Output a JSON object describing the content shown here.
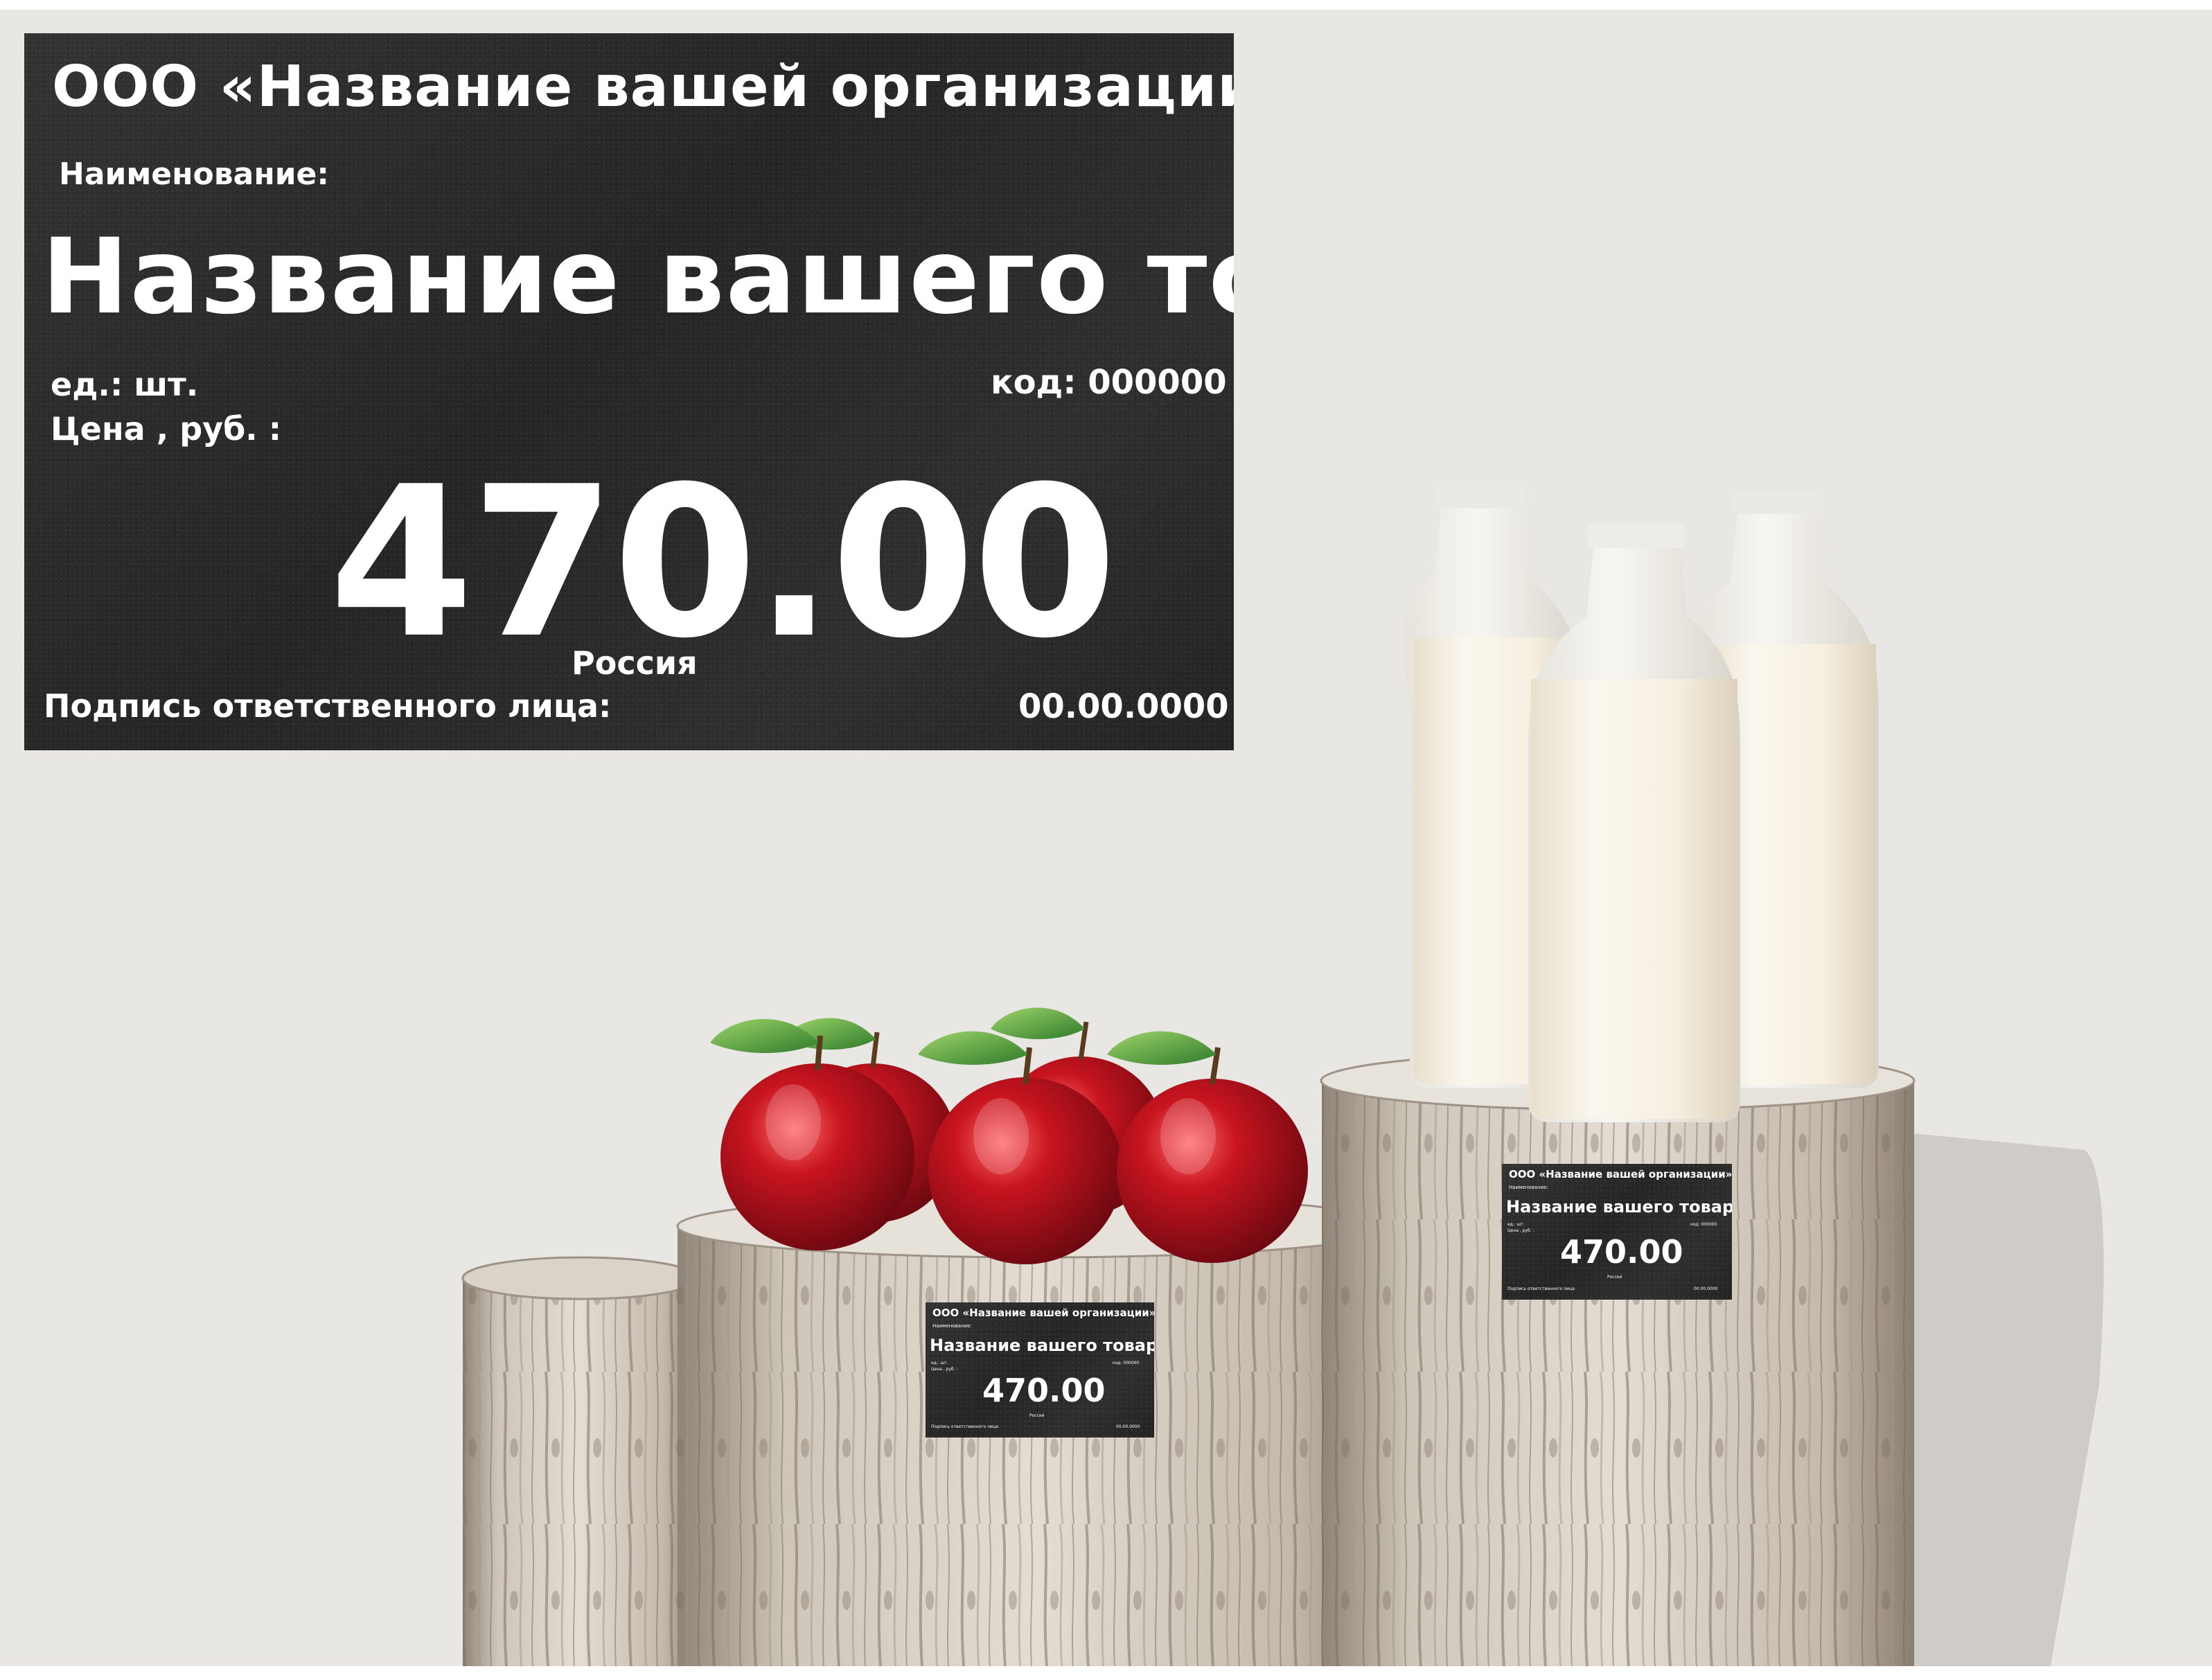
{
  "price_tag": {
    "organization": "ООО «Название вашей организации»",
    "name_label": "Наименование:",
    "product_name": "Название вашего товара",
    "unit": "ед.: шт.",
    "code": "код: 000000",
    "price_label": "Цена , руб. :",
    "price": "470.00",
    "country": "Россия",
    "signature_label": "Подпись ответственного лица:",
    "date": "00.00.0000"
  },
  "colors": {
    "background": "#e9e7e4",
    "board": "#2c2c2c",
    "apple": "#a8101c",
    "milk": "#f3ecdc",
    "wood": "#cfc7bd"
  }
}
